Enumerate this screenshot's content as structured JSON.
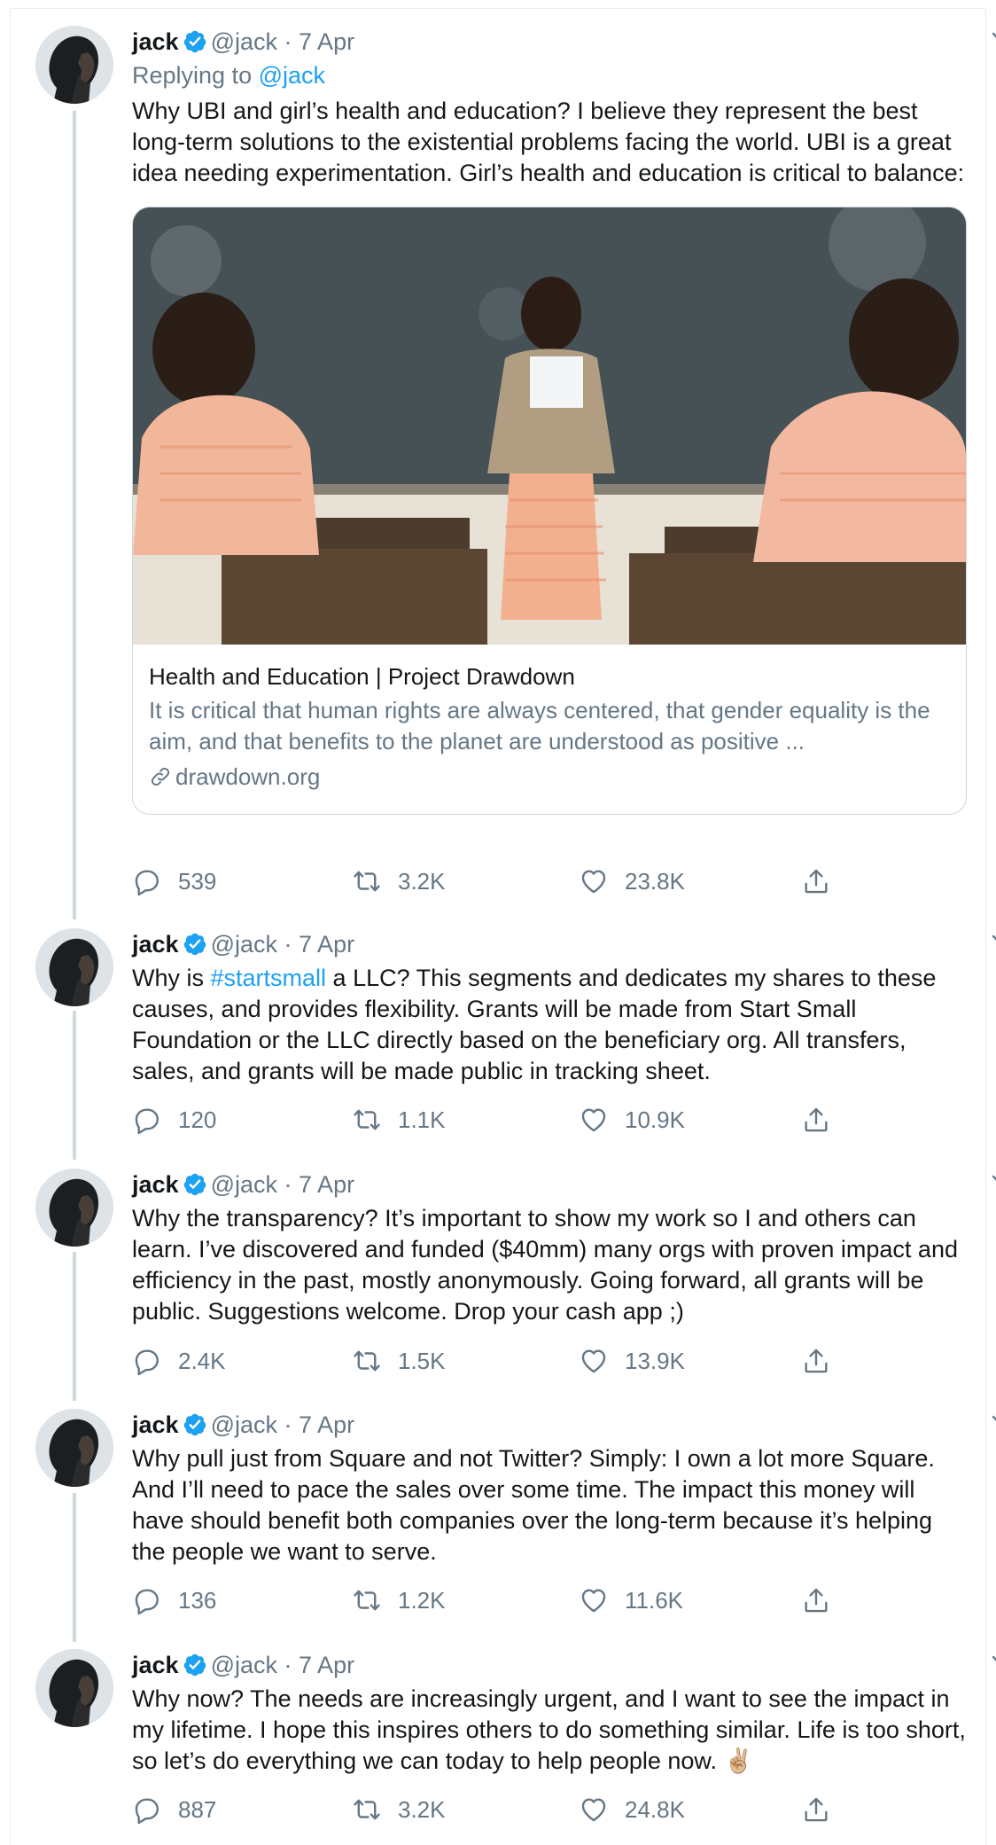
{
  "colors": {
    "link": "#1da1f2",
    "muted": "#657786",
    "text": "#14171a",
    "border": "#e6ecf0"
  },
  "tweets": [
    {
      "name": "jack",
      "handle": "@jack",
      "dot": "·",
      "date": "7 Apr",
      "replying_prefix": "Replying to",
      "replying_handle": "@jack",
      "text": "Why UBI and girl’s health and education? I believe they represent the best long-term solutions to the existential problems facing the world. UBI is a great idea needing experimentation. Girl’s health and education is critical to balance:",
      "card": {
        "image_description_icon": "classroom-photo",
        "title": "Health and Education | Project Drawdown",
        "description": "It is critical that human rights are always centered, that gender equality is the aim, and that benefits to the planet are understood as positive ...",
        "domain": "drawdown.org"
      },
      "replies": "539",
      "retweets": "3.2K",
      "likes": "23.8K"
    },
    {
      "name": "jack",
      "handle": "@jack",
      "dot": "·",
      "date": "7 Apr",
      "text_before": "Why is ",
      "hashtag": "#startsmall",
      "text_after": " a LLC? This segments and dedicates my shares to these causes, and provides flexibility. Grants will be made from Start Small Foundation or the LLC directly based on the beneficiary org. All transfers, sales, and grants will be made public in tracking sheet.",
      "replies": "120",
      "retweets": "1.1K",
      "likes": "10.9K"
    },
    {
      "name": "jack",
      "handle": "@jack",
      "dot": "·",
      "date": "7 Apr",
      "text": "Why the transparency? It’s important to show my work so I and others can learn. I’ve discovered and funded ($40mm) many orgs with proven impact and efficiency in the past, mostly anonymously. Going forward, all grants will be public. Suggestions welcome. Drop your cash app ;)",
      "replies": "2.4K",
      "retweets": "1.5K",
      "likes": "13.9K"
    },
    {
      "name": "jack",
      "handle": "@jack",
      "dot": "·",
      "date": "7 Apr",
      "text": "Why pull just from Square and not Twitter? Simply: I own a lot more Square. And I’ll  need to pace the sales over some time. The impact this money will have should benefit both companies over the long-term because it’s helping the people we want to serve.",
      "replies": "136",
      "retweets": "1.2K",
      "likes": "11.6K"
    },
    {
      "name": "jack",
      "handle": "@jack",
      "dot": "·",
      "date": "7 Apr",
      "text": "Why now? The needs are increasingly urgent, and I want to see the impact in my lifetime. I hope this inspires others to do something similar. Life is too short, so let’s do everything we can today to help people now. ✌🏼",
      "replies": "887",
      "retweets": "3.2K",
      "likes": "24.8K"
    }
  ]
}
